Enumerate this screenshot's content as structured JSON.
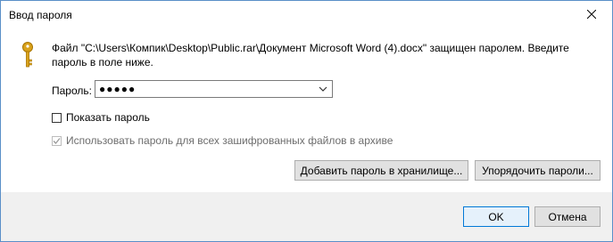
{
  "window": {
    "title": "Ввод пароля"
  },
  "message": "Файл \"C:\\Users\\Компик\\Desktop\\Public.rar\\Документ Microsoft Word (4).docx\" защищен паролем. Введите пароль в поле ниже.",
  "password": {
    "label": "Пароль:",
    "value": "●●●●●"
  },
  "show_password": {
    "label": "Показать пароль",
    "checked": false
  },
  "use_for_all": {
    "label": "Использовать пароль для всех зашифрованных файлов в архиве",
    "checked": true,
    "disabled": true
  },
  "buttons": {
    "add_to_store": "Добавить пароль в хранилище...",
    "organize": "Упорядочить пароли...",
    "ok": "OK",
    "cancel": "Отмена"
  },
  "colors": {
    "accent": "#0078d7",
    "key_icon": "#d9a21b"
  }
}
